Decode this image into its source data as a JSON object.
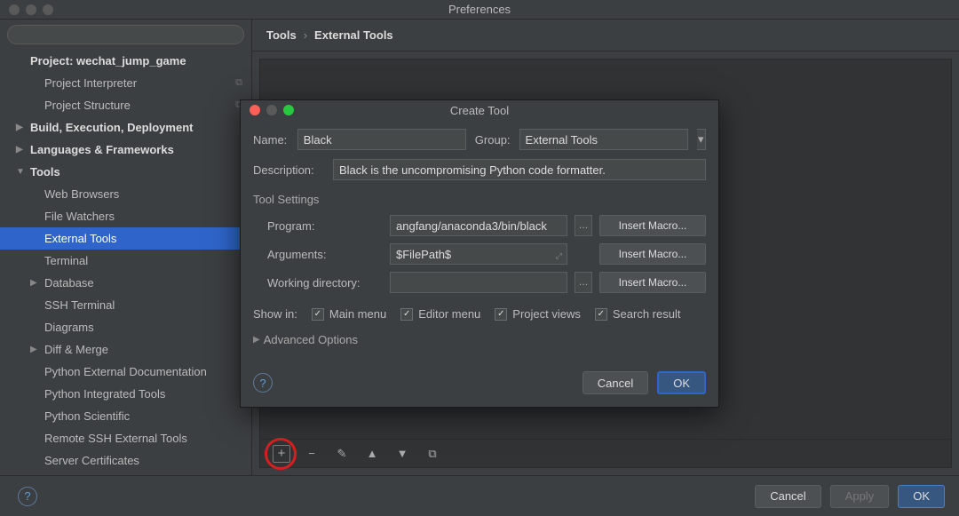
{
  "window": {
    "title": "Preferences"
  },
  "search": {
    "placeholder": ""
  },
  "sidebar": {
    "project_header": "Project: wechat_jump_game",
    "items": [
      {
        "label": "Project Interpreter",
        "level": "level1b",
        "selected": false,
        "has_right_icon": true
      },
      {
        "label": "Project Structure",
        "level": "level1b",
        "selected": false,
        "has_right_icon": true
      },
      {
        "label": "Build, Execution, Deployment",
        "level": "level0",
        "arrow": "▶",
        "selected": false
      },
      {
        "label": "Languages & Frameworks",
        "level": "level0",
        "arrow": "▶",
        "selected": false
      },
      {
        "label": "Tools",
        "level": "level0",
        "arrow": "▼",
        "selected": false
      },
      {
        "label": "Web Browsers",
        "level": "level1b",
        "selected": false
      },
      {
        "label": "File Watchers",
        "level": "level1b",
        "selected": false
      },
      {
        "label": "External Tools",
        "level": "level1b",
        "selected": true
      },
      {
        "label": "Terminal",
        "level": "level1b",
        "selected": false
      },
      {
        "label": "Database",
        "level": "level1",
        "arrow": "▶",
        "selected": false
      },
      {
        "label": "SSH Terminal",
        "level": "level1b",
        "selected": false
      },
      {
        "label": "Diagrams",
        "level": "level1b",
        "selected": false
      },
      {
        "label": "Diff & Merge",
        "level": "level1",
        "arrow": "▶",
        "selected": false
      },
      {
        "label": "Python External Documentation",
        "level": "level1b",
        "selected": false
      },
      {
        "label": "Python Integrated Tools",
        "level": "level1b",
        "selected": false
      },
      {
        "label": "Python Scientific",
        "level": "level1b",
        "selected": false
      },
      {
        "label": "Remote SSH External Tools",
        "level": "level1b",
        "selected": false
      },
      {
        "label": "Server Certificates",
        "level": "level1b",
        "selected": false
      }
    ]
  },
  "breadcrumb": {
    "root": "Tools",
    "sep": "›",
    "current": "External Tools"
  },
  "toolbar": {
    "add": "+",
    "remove": "−",
    "edit": "✎",
    "up": "▲",
    "down": "▼",
    "copy": "⧉"
  },
  "footer": {
    "cancel": "Cancel",
    "apply": "Apply",
    "ok": "OK",
    "help": "?"
  },
  "modal": {
    "title": "Create Tool",
    "name_label": "Name:",
    "name_value": "Black",
    "group_label": "Group:",
    "group_value": "External Tools",
    "desc_label": "Description:",
    "desc_value": "Black is the uncompromising Python code formatter.",
    "section": "Tool Settings",
    "program_label": "Program:",
    "program_value": "angfang/anaconda3/bin/black",
    "arguments_label": "Arguments:",
    "arguments_value": "$FilePath$",
    "wd_label": "Working directory:",
    "wd_value": "",
    "macro_btn": "Insert Macro...",
    "browse": "…",
    "show_in_label": "Show in:",
    "checks": [
      {
        "label": "Main menu",
        "checked": true
      },
      {
        "label": "Editor menu",
        "checked": true
      },
      {
        "label": "Project views",
        "checked": true
      },
      {
        "label": "Search result",
        "checked": true
      }
    ],
    "advanced": "Advanced Options",
    "help": "?",
    "cancel": "Cancel",
    "ok": "OK"
  }
}
